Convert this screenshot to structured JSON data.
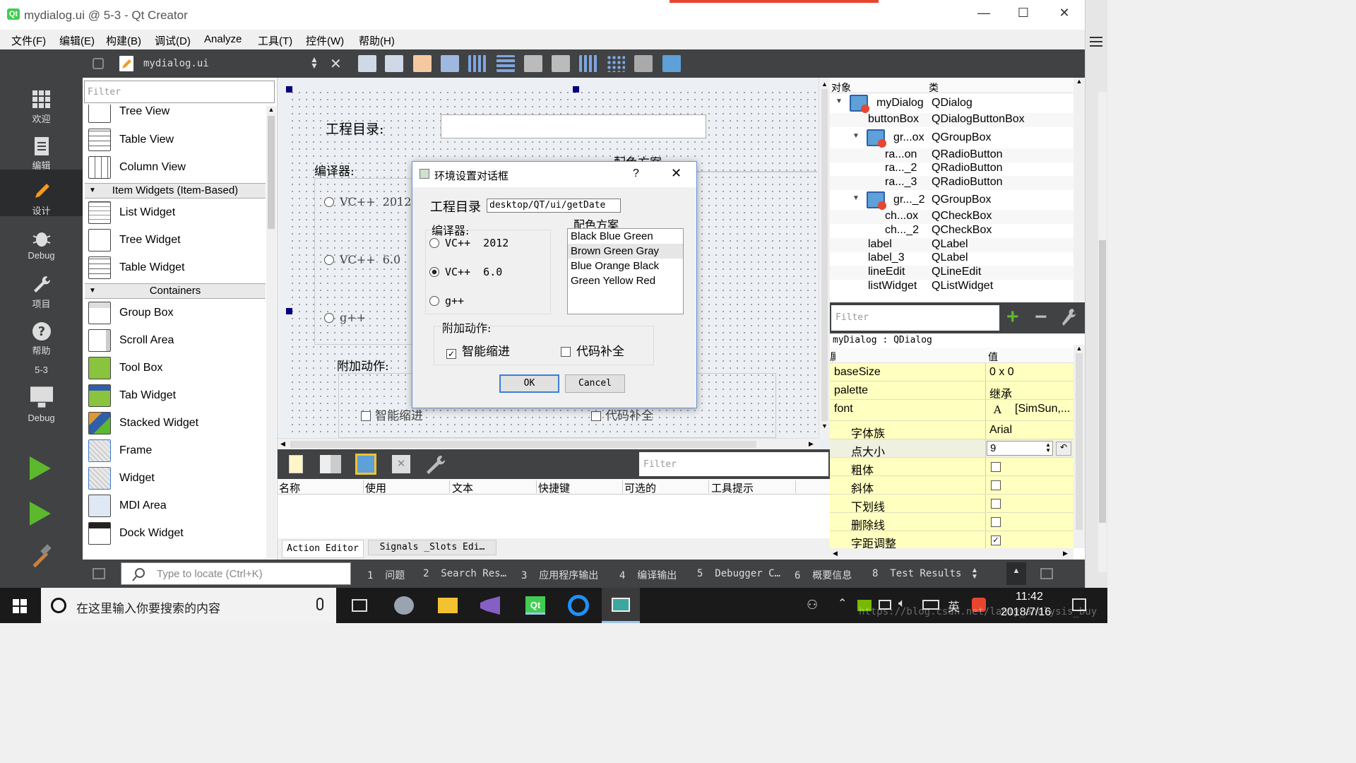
{
  "window": {
    "title": "mydialog.ui @ 5-3 - Qt Creator"
  },
  "menu": [
    "文件(F)",
    "编辑(E)",
    "构建(B)",
    "调试(D)",
    "Analyze",
    "工具(T)",
    "控件(W)",
    "帮助(H)"
  ],
  "modes": [
    {
      "label": "欢迎",
      "icon": "grid-icon"
    },
    {
      "label": "编辑",
      "icon": "document-icon"
    },
    {
      "label": "设计",
      "icon": "pencil-icon"
    },
    {
      "label": "Debug",
      "icon": "bug-icon"
    },
    {
      "label": "项目",
      "icon": "wrench-icon"
    },
    {
      "label": "帮助",
      "icon": "help-icon"
    }
  ],
  "kit": {
    "project": "5-3",
    "label": "Debug"
  },
  "editor": {
    "file": "mydialog.ui"
  },
  "widgetbox": {
    "filter_placeholder": "Filter",
    "items_top": [
      "Tree View",
      "Table View",
      "Column View"
    ],
    "cat_item_widgets": "Item Widgets (Item-Based)",
    "items_item": [
      "List Widget",
      "Tree Widget",
      "Table Widget"
    ],
    "cat_containers": "Containers",
    "items_containers": [
      "Group Box",
      "Scroll Area",
      "Tool Box",
      "Tab Widget",
      "Stacked Widget",
      "Frame",
      "Widget",
      "MDI Area",
      "Dock Widget"
    ]
  },
  "form": {
    "dir_label": "工程目录:",
    "compiler_label": "编译器:",
    "color_label": "配色方案",
    "radios": [
      "VC++  2012",
      "VC++  6.0",
      "g++"
    ],
    "extra_label": "附加动作:",
    "checks": [
      "智能缩进",
      "代码补全"
    ]
  },
  "dialog": {
    "title": "环境设置对话框",
    "help": "?",
    "close": "✕",
    "dir_label": "工程目录",
    "dir_value": "desktop/QT/ui/getDate",
    "compiler_label": "编译器:",
    "radios": [
      "VC++  2012",
      "VC++  6.0",
      "g++"
    ],
    "radio_selected": 1,
    "color_label": "配色方案",
    "colors": [
      "Black Blue Green",
      "Brown Green Gray",
      "Blue Orange Black",
      "Green Yellow Red"
    ],
    "color_selected": 1,
    "extra_label": "附加动作:",
    "checks": [
      "智能缩进",
      "代码补全"
    ],
    "checks_state": [
      true,
      false
    ],
    "ok": "OK",
    "cancel": "Cancel"
  },
  "objinsp": {
    "col_object": "对象",
    "col_class": "类",
    "rows": [
      {
        "obj": "myDialog",
        "cls": "QDialog"
      },
      {
        "obj": "buttonBox",
        "cls": "QDialogButtonBox"
      },
      {
        "obj": "gr...ox",
        "cls": "QGroupBox"
      },
      {
        "obj": "ra...on",
        "cls": "QRadioButton"
      },
      {
        "obj": "ra..._2",
        "cls": "QRadioButton"
      },
      {
        "obj": "ra..._3",
        "cls": "QRadioButton"
      },
      {
        "obj": "gr..._2",
        "cls": "QGroupBox"
      },
      {
        "obj": "ch...ox",
        "cls": "QCheckBox"
      },
      {
        "obj": "ch..._2",
        "cls": "QCheckBox"
      },
      {
        "obj": "label",
        "cls": "QLabel"
      },
      {
        "obj": "label_3",
        "cls": "QLabel"
      },
      {
        "obj": "lineEdit",
        "cls": "QLineEdit"
      },
      {
        "obj": "listWidget",
        "cls": "QListWidget"
      }
    ]
  },
  "propedit": {
    "filter_placeholder": "Filter",
    "context": "myDialog : QDialog",
    "col_prop": "属",
    "col_value": "值",
    "rows": [
      {
        "name": "baseSize",
        "value": "0 x 0"
      },
      {
        "name": "palette",
        "value": "继承"
      },
      {
        "name": "font",
        "value": "[SimSun,..."
      },
      {
        "name": "字体族",
        "value": "Arial"
      },
      {
        "name": "点大小",
        "value": "9"
      },
      {
        "name": "粗体",
        "value": ""
      },
      {
        "name": "斜体",
        "value": ""
      },
      {
        "name": "下划线",
        "value": ""
      },
      {
        "name": "删除线",
        "value": ""
      },
      {
        "name": "字距调整",
        "value": ""
      }
    ]
  },
  "actedit": {
    "filter_placeholder": "Filter",
    "cols": [
      "名称",
      "使用",
      "文本",
      "快捷键",
      "可选的",
      "工具提示"
    ],
    "tabs": [
      "Action Editor",
      "Signals _Slots Edi…"
    ]
  },
  "status": {
    "locate_placeholder": "Type to locate (Ctrl+K)",
    "tabs": [
      "1  问题",
      "2  Search Res…",
      "3  应用程序输出",
      "4  编译输出",
      "5  Debugger C…",
      "6  概要信息",
      "8  Test Results"
    ]
  },
  "taskbar": {
    "search_placeholder": "在这里输入你要搜索的内容",
    "time": "11:42",
    "date": "2018/7/16",
    "ime": "英",
    "watermark": "https://blog.csdn.net/lanmy_analysis_buy"
  },
  "colors": {
    "accent": "#e8452f",
    "dark": "#404244",
    "prop_yellow": "#ffffbf",
    "select": "#e6e6e6"
  }
}
